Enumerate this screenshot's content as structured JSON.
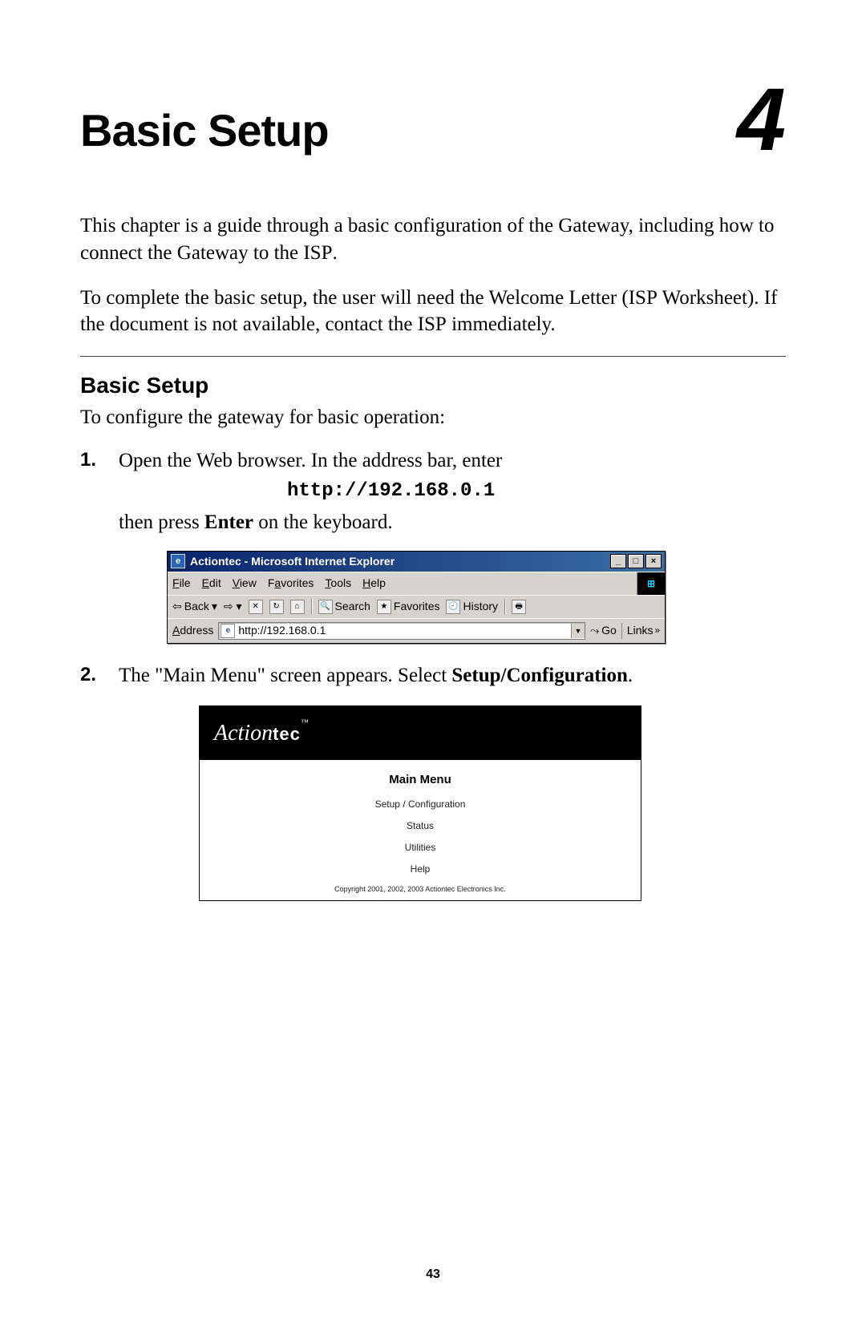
{
  "chapter": {
    "title": "Basic Setup",
    "number": "4"
  },
  "intro": {
    "p1_a": "This chapter is a guide through a basic configuration of the Gateway, including how to connect the Gateway to the ",
    "p1_isp": "ISP",
    "p1_b": ".",
    "p2_a": "To complete the basic setup, the user will need the Welcome Letter (",
    "p2_isp1": "ISP",
    "p2_b": " Worksheet). If the document is not available, contact the ",
    "p2_isp2": "ISP",
    "p2_c": " immediately."
  },
  "section": {
    "title": "Basic Setup",
    "lead": "To configure the gateway for basic operation:"
  },
  "steps": {
    "s1_a": "Open the Web browser. In the address bar, enter",
    "s1_url": "http://192.168.0.1",
    "s1_b_a": "then press ",
    "s1_b_bold": "Enter",
    "s1_b_b": " on the keyboard.",
    "s2_a": "The \"Main Menu\" screen appears. Select ",
    "s2_bold": "Setup/Configuration",
    "s2_b": "."
  },
  "ie": {
    "title": "Actiontec - Microsoft Internet Explorer",
    "win_min": "_",
    "win_max": "□",
    "win_close": "×",
    "menu": {
      "file_u": "F",
      "file_r": "ile",
      "edit_u": "E",
      "edit_r": "dit",
      "view_u": "V",
      "view_r": "iew",
      "fav_u": "a",
      "fav_pre": "F",
      "fav_r": "vorites",
      "tools_u": "T",
      "tools_r": "ools",
      "help_u": "H",
      "help_r": "elp"
    },
    "toolbar": {
      "back": "Back",
      "search": "Search",
      "favorites": "Favorites",
      "history": "History"
    },
    "address": {
      "label_u": "A",
      "label_r": "ddress",
      "value": "http://192.168.0.1",
      "go": "Go",
      "links": "Links",
      "links_chevron": "»"
    }
  },
  "actiontec": {
    "logo_script": "Action",
    "logo_tec": "tec",
    "tm": "™",
    "title": "Main Menu",
    "items": [
      "Setup / Configuration",
      "Status",
      "Utilities",
      "Help"
    ],
    "copyright": "Copyright 2001, 2002, 2003 Actiontec Electronics Inc."
  },
  "page_number": "43"
}
